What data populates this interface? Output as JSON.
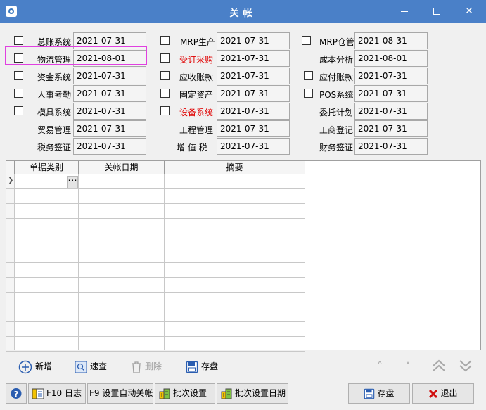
{
  "window": {
    "title": "关帐"
  },
  "modules": {
    "col1": [
      {
        "label": "总账系统",
        "date": "2021-07-31",
        "checkbox": true
      },
      {
        "label": "物流管理",
        "date": "2021-08-01",
        "checkbox": true
      },
      {
        "label": "资金系统",
        "date": "2021-07-31",
        "checkbox": true
      },
      {
        "label": "人事考勤",
        "date": "2021-07-31",
        "checkbox": true
      },
      {
        "label": "模具系统",
        "date": "2021-07-31",
        "checkbox": true
      },
      {
        "label": "贸易管理",
        "date": "2021-07-31",
        "checkbox": false
      },
      {
        "label": "税务签证",
        "date": "2021-07-31",
        "checkbox": false
      }
    ],
    "col2": [
      {
        "label": "MRP生产",
        "date": "2021-07-31",
        "checkbox": true,
        "red": false
      },
      {
        "label": "受订采购",
        "date": "2021-07-31",
        "checkbox": true,
        "red": true
      },
      {
        "label": "应收账款",
        "date": "2021-07-31",
        "checkbox": true,
        "red": false
      },
      {
        "label": "固定资产",
        "date": "2021-07-31",
        "checkbox": true,
        "red": false
      },
      {
        "label": "设备系统",
        "date": "2021-07-31",
        "checkbox": true,
        "red": true
      },
      {
        "label": "工程管理",
        "date": "2021-07-31",
        "checkbox": false,
        "red": false
      },
      {
        "label": "增 值 税",
        "date": "2021-07-31",
        "checkbox": false,
        "red": false
      }
    ],
    "col3": [
      {
        "label": "MRP仓管",
        "date": "2021-08-31",
        "checkbox": true
      },
      {
        "label": "成本分析",
        "date": "2021-08-01",
        "checkbox": false
      },
      {
        "label": "应付账款",
        "date": "2021-07-31",
        "checkbox": true
      },
      {
        "label": "POS系统",
        "date": "2021-07-31",
        "checkbox": true
      },
      {
        "label": "委托计划",
        "date": "2021-07-31",
        "checkbox": false
      },
      {
        "label": "工商登记",
        "date": "2021-07-31",
        "checkbox": false
      },
      {
        "label": "财务签证",
        "date": "2021-07-31",
        "checkbox": false
      }
    ]
  },
  "grid": {
    "columns": [
      "单据类别",
      "关帐日期",
      "摘要"
    ],
    "ellipsis": "···"
  },
  "toolbar": {
    "add": "新增",
    "search": "速查",
    "delete": "删除",
    "save": "存盘"
  },
  "bottom": {
    "help": "?",
    "log": "F10 日志",
    "auto": "F9 设置自动关帐",
    "batch": "批次设置",
    "batch_date": "批次设置日期",
    "save": "存盘",
    "exit": "退出"
  },
  "colors": {
    "titlebar": "#4a80c8",
    "highlight": "#e040e0",
    "red_label": "#e00000"
  }
}
